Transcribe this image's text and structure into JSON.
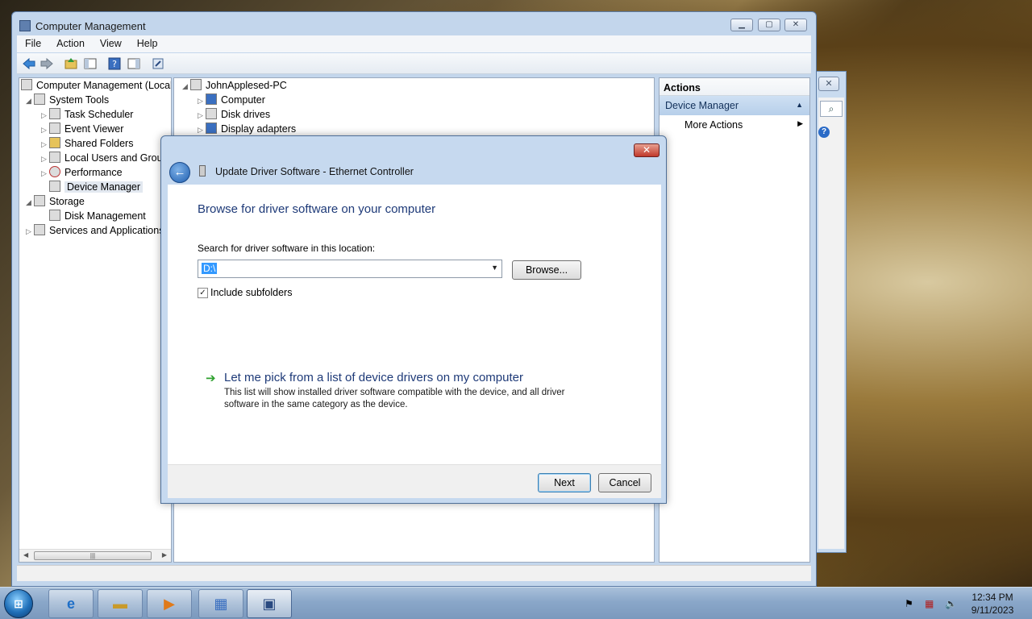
{
  "main_window": {
    "title": "Computer Management",
    "menu": [
      "File",
      "Action",
      "View",
      "Help"
    ],
    "tree": [
      {
        "label": "Computer Management (Local",
        "arrow": "",
        "indent": 0
      },
      {
        "label": "System Tools",
        "arrow": "◢",
        "indent": 1
      },
      {
        "label": "Task Scheduler",
        "arrow": "▷",
        "indent": 2
      },
      {
        "label": "Event Viewer",
        "arrow": "▷",
        "indent": 2
      },
      {
        "label": "Shared Folders",
        "arrow": "▷",
        "indent": 2
      },
      {
        "label": "Local Users and Group",
        "arrow": "▷",
        "indent": 2
      },
      {
        "label": "Performance",
        "arrow": "▷",
        "indent": 2
      },
      {
        "label": "Device Manager",
        "arrow": "",
        "indent": 2
      },
      {
        "label": "Storage",
        "arrow": "◢",
        "indent": 1
      },
      {
        "label": "Disk Management",
        "arrow": "",
        "indent": 2
      },
      {
        "label": "Services and Applications",
        "arrow": "▷",
        "indent": 1
      }
    ],
    "center": {
      "root": "JohnApplesed-PC",
      "items": [
        "Computer",
        "Disk drives",
        "Display adapters"
      ]
    },
    "actions": {
      "header": "Actions",
      "section": "Device Manager",
      "more": "More Actions"
    }
  },
  "dialog": {
    "title": "Update Driver Software - Ethernet Controller",
    "heading": "Browse for driver software on your computer",
    "search_label": "Search for driver software in this location:",
    "path_value": "D:\\",
    "browse_label": "Browse...",
    "include_subfolders_label": "Include subfolders",
    "include_subfolders_checked": true,
    "pick_link": "Let me pick from a list of device drivers on my computer",
    "pick_desc": "This list will show installed driver software compatible with the device, and all driver software in the same category as the device.",
    "next_label": "Next",
    "cancel_label": "Cancel"
  },
  "taskbar": {
    "time": "12:34 PM",
    "date": "9/11/2023"
  }
}
